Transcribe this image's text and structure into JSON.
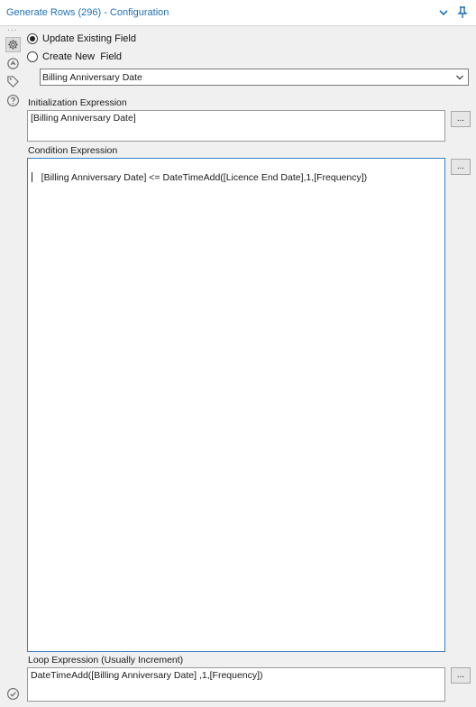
{
  "window": {
    "title": "Generate Rows (296) - Configuration"
  },
  "sidebar": {
    "dots": "...",
    "items": [
      {
        "name": "configuration",
        "icon": "gear-icon",
        "active": true
      },
      {
        "name": "annotation",
        "icon": "annotation-icon",
        "active": false
      },
      {
        "name": "tags",
        "icon": "tag-icon",
        "active": false
      },
      {
        "name": "help",
        "icon": "help-icon",
        "active": false
      }
    ],
    "bottom_icon": "check-circle-icon"
  },
  "mode": {
    "options": [
      {
        "label": "Update Existing Field",
        "selected": true
      },
      {
        "label": "Create New  Field",
        "selected": false
      }
    ]
  },
  "field_select": {
    "value": "Billing Anniversary Date"
  },
  "init_expression": {
    "label": "Initialization Expression",
    "value": "[Billing Anniversary Date]",
    "button": "..."
  },
  "condition_expression": {
    "label": "Condition Expression",
    "value": "[Billing Anniversary Date] <= DateTimeAdd([Licence End Date],1,[Frequency])",
    "button": "..."
  },
  "loop_expression": {
    "label": "Loop Expression (Usually Increment)",
    "value": "DateTimeAdd([Billing Anniversary Date] ,1,[Frequency])",
    "button": "..."
  },
  "colors": {
    "title": "#1f6fb4",
    "focus_border": "#3a7fc4",
    "icon_gray": "#6b6b6b"
  }
}
